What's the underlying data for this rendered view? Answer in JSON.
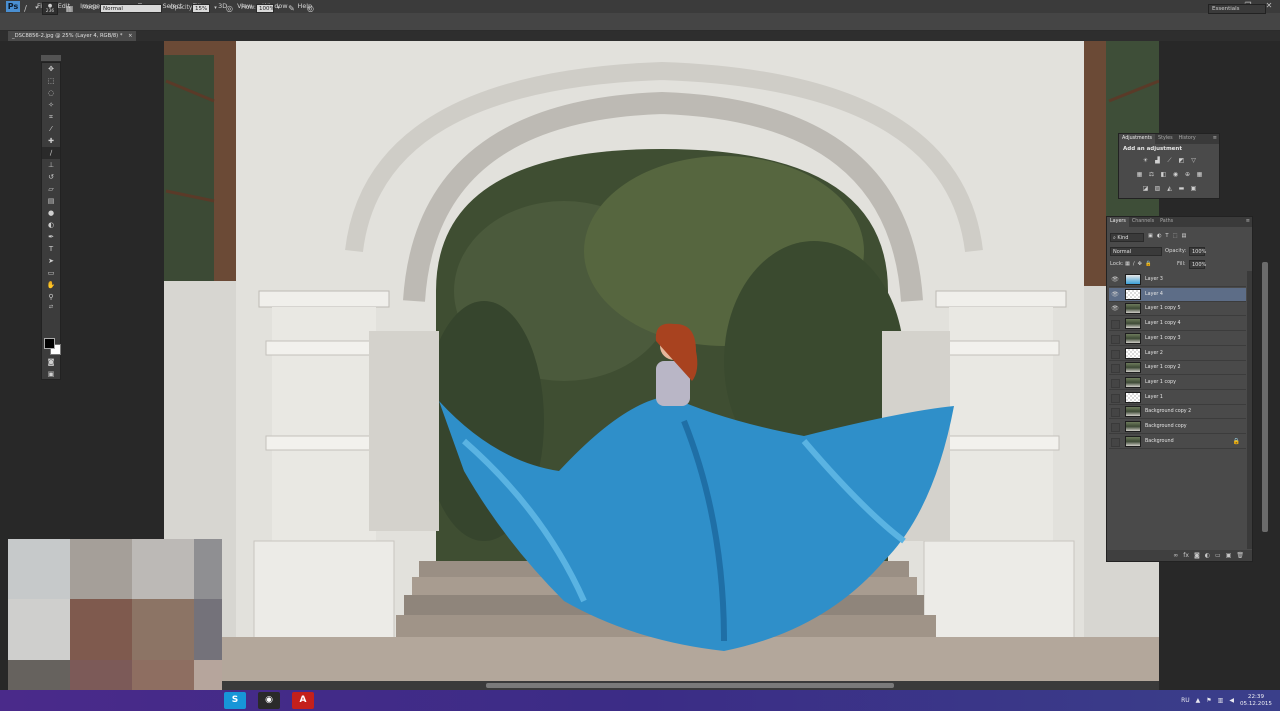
{
  "app": {
    "logo": "Ps",
    "menu": [
      "File",
      "Edit",
      "Image",
      "Layer",
      "Type",
      "Select",
      "Filter",
      "3D",
      "View",
      "Window",
      "Help"
    ],
    "window_buttons": [
      "minimize-icon",
      "restore-icon",
      "close-icon"
    ]
  },
  "options_bar": {
    "brush_size": "236",
    "mode_label": "Mode:",
    "mode_value": "Normal",
    "opacity_label": "Opacity:",
    "opacity_value": "15%",
    "flow_label": "Flow:",
    "flow_value": "100%",
    "workspace": "Essentials"
  },
  "document_tab": {
    "title": "_DSC8856-2.jpg @ 25% (Layer 4, RGB/8) *",
    "close": "×"
  },
  "adjustments_panel": {
    "tabs": [
      "Adjustments",
      "Styles",
      "History"
    ],
    "active_tab": "Adjustments",
    "title": "Add an adjustment"
  },
  "layers_panel": {
    "tabs": [
      "Layers",
      "Channels",
      "Paths"
    ],
    "active_tab": "Layers",
    "filter_kind": "Kind",
    "blend_mode": "Normal",
    "opacity_label": "Opacity:",
    "opacity_value": "100%",
    "lock_label": "Lock:",
    "fill_label": "Fill:",
    "fill_value": "100%",
    "layers": [
      {
        "name": "Layer 3",
        "visible": true,
        "thumb": "blue",
        "selected": false
      },
      {
        "name": "Layer 4",
        "visible": true,
        "thumb": "trans",
        "selected": true
      },
      {
        "name": "Layer 1 copy 5",
        "visible": true,
        "thumb": "photo",
        "selected": false
      },
      {
        "name": "Layer 1 copy 4",
        "visible": false,
        "thumb": "photo",
        "selected": false
      },
      {
        "name": "Layer 1 copy 3",
        "visible": false,
        "thumb": "photo",
        "selected": false
      },
      {
        "name": "Layer 2",
        "visible": false,
        "thumb": "trans",
        "selected": false
      },
      {
        "name": "Layer 1 copy 2",
        "visible": false,
        "thumb": "photo",
        "selected": false
      },
      {
        "name": "Layer 1 copy",
        "visible": false,
        "thumb": "photo",
        "selected": false
      },
      {
        "name": "Layer 1",
        "visible": false,
        "thumb": "trans",
        "selected": false
      },
      {
        "name": "Background copy 2",
        "visible": false,
        "thumb": "photo",
        "selected": false
      },
      {
        "name": "Background copy",
        "visible": false,
        "thumb": "photo",
        "selected": false
      },
      {
        "name": "Background",
        "visible": false,
        "thumb": "photo",
        "selected": false,
        "locked": true
      }
    ]
  },
  "pixelated_overlay": {
    "colors": [
      "#c6c9ca",
      "#a59f99",
      "#bcb9b6",
      "#8f8f92",
      "#cfcfcd",
      "#7f5a4e",
      "#8c7465",
      "#74727a",
      "#66625e",
      "#7c5a58",
      "#8e6e61",
      "#b6a59c"
    ]
  },
  "taskbar": {
    "apps": [
      {
        "label": "S",
        "color": "#1796d8"
      },
      {
        "label": "◉",
        "color": "#2a2a2a"
      },
      {
        "label": "A",
        "color": "#c4201b"
      }
    ],
    "language": "RU",
    "time": "22:39",
    "date": "05.12.2015"
  }
}
